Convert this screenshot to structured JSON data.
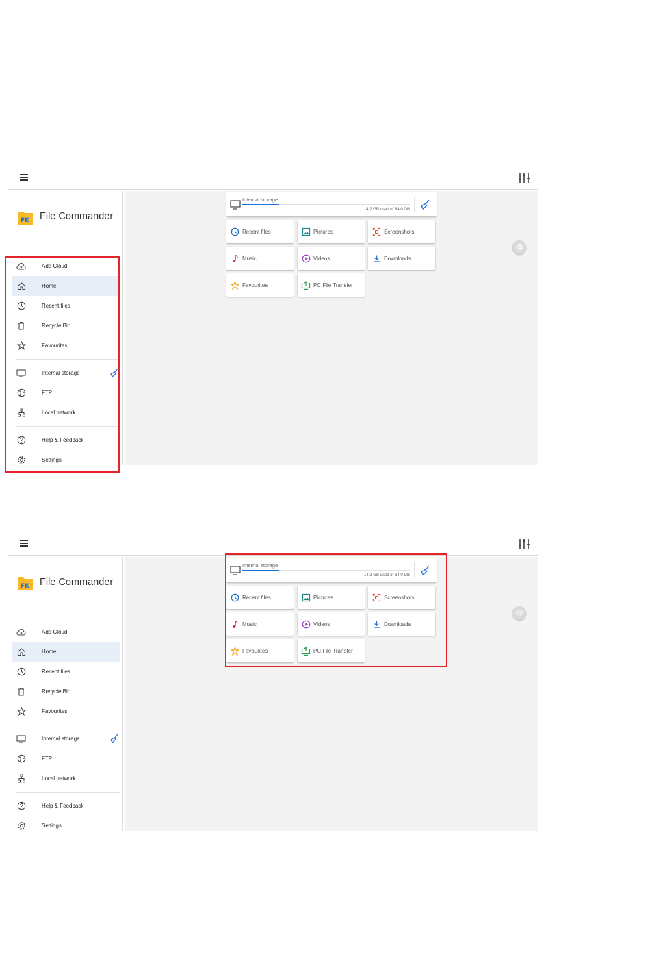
{
  "app": {
    "title": "File Commander"
  },
  "sidebar": {
    "items": [
      {
        "label": "Add Cloud",
        "icon": "cloud-add-icon"
      },
      {
        "label": "Home",
        "icon": "home-icon",
        "active": true
      },
      {
        "label": "Recent files",
        "icon": "clock-icon"
      },
      {
        "label": "Recycle Bin",
        "icon": "trash-icon"
      },
      {
        "label": "Favourites",
        "icon": "star-icon"
      },
      {
        "label": "Internal storage",
        "icon": "monitor-icon",
        "action_icon": "broom-icon"
      },
      {
        "label": "FTP",
        "icon": "globe-icon"
      },
      {
        "label": "Local network",
        "icon": "network-icon"
      },
      {
        "label": "Help & Feedback",
        "icon": "help-icon"
      },
      {
        "label": "Settings",
        "icon": "gear-icon"
      }
    ]
  },
  "storage": {
    "label": "Internal storage",
    "usage_text": "14.2 GB used of 64.0 GB",
    "used_fraction": 0.22
  },
  "tiles": [
    {
      "label": "Recent files",
      "icon": "clock-icon",
      "color": "#1f6fc4"
    },
    {
      "label": "Pictures",
      "icon": "image-icon",
      "color": "#1f8c8a"
    },
    {
      "label": "Screenshots",
      "icon": "screenshot-icon",
      "color": "#e0563b"
    },
    {
      "label": "Music",
      "icon": "music-note-icon",
      "color": "#d6286b"
    },
    {
      "label": "Videos",
      "icon": "play-circle-icon",
      "color": "#a246c4"
    },
    {
      "label": "Downloads",
      "icon": "download-icon",
      "color": "#2a7ad6"
    },
    {
      "label": "Favourites",
      "icon": "star-icon",
      "color": "#f2a21b"
    },
    {
      "label": "PC File Transfer",
      "icon": "pc-transfer-icon",
      "color": "#2e9b4f"
    }
  ],
  "colors": {
    "accent": "#1e6fd9",
    "highlight": "#e3242b",
    "content_bg": "#f3f3f3",
    "active_item_bg": "#e7eef7"
  }
}
